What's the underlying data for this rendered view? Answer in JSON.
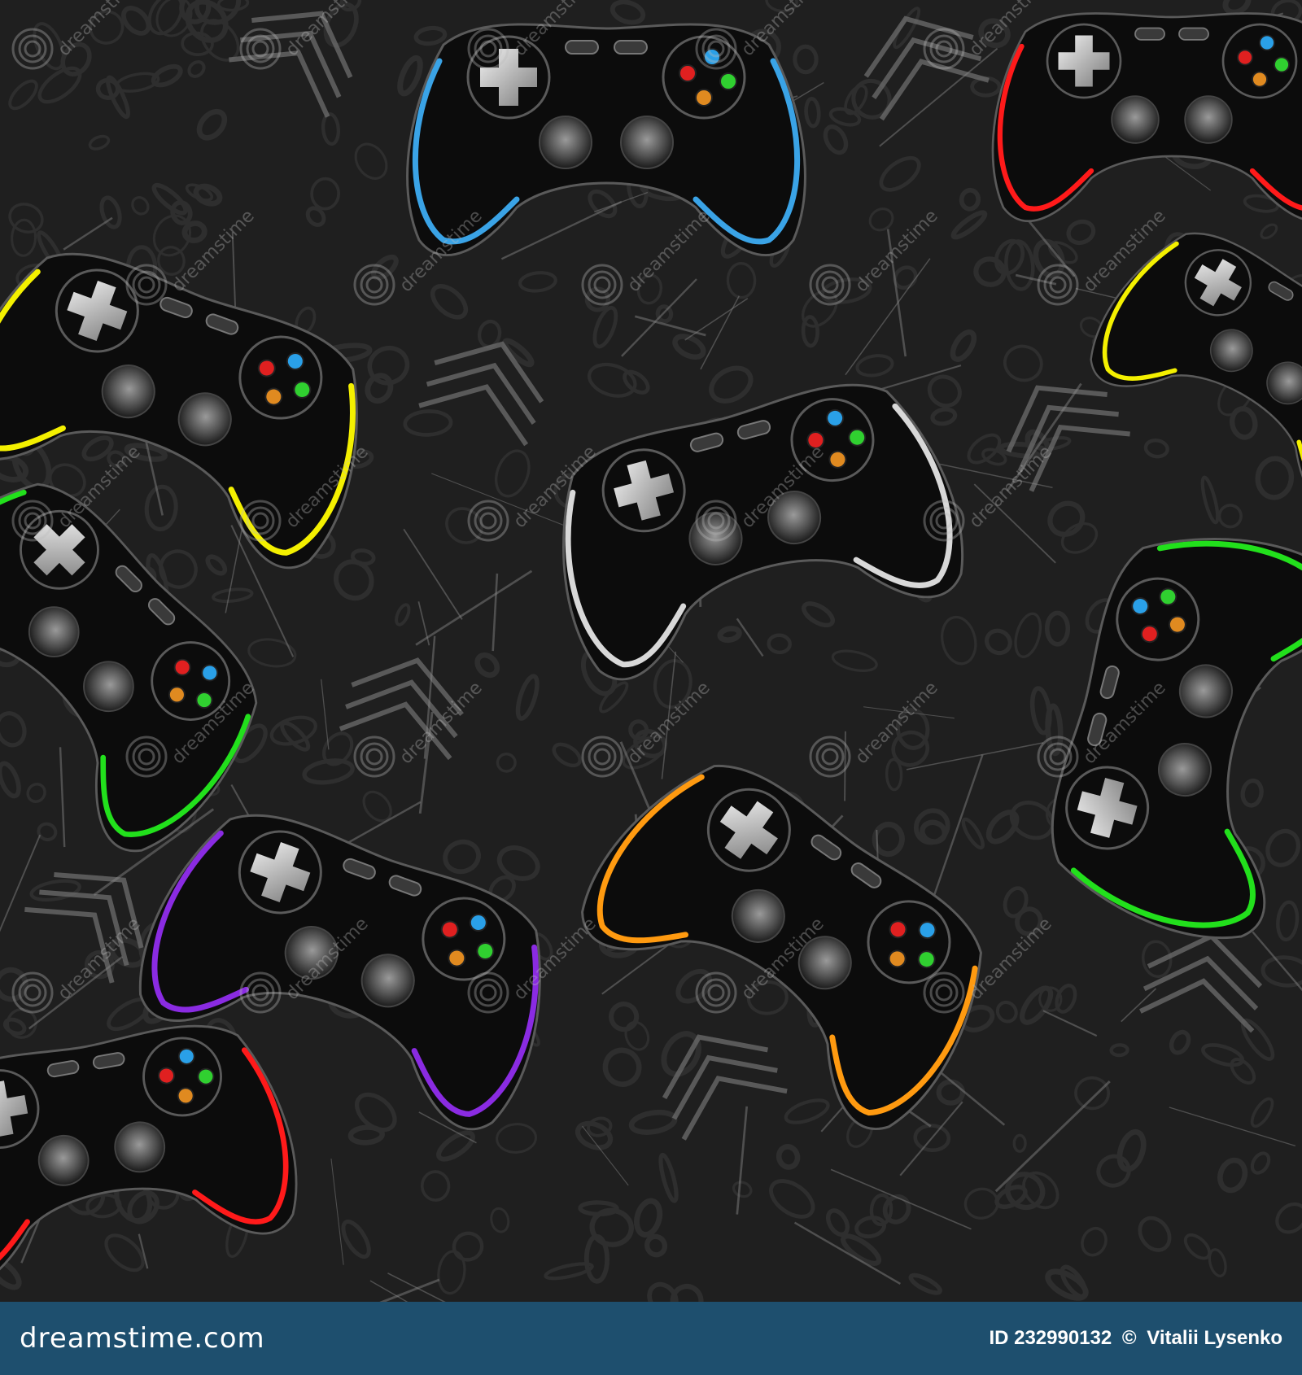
{
  "artwork": {
    "description_text": "",
    "background_color": "#1f1f1f",
    "texture_color": "#2e2e2e",
    "pattern_color": "#6d6d6d",
    "controller_body_color": "#0c0c0c",
    "controller_outline_color": "#5a5a5a",
    "controllers": [
      {
        "accent_color": "#3aa3e6",
        "icon": "gamepad-icon"
      },
      {
        "accent_color": "#ff1a1a",
        "icon": "gamepad-icon"
      },
      {
        "accent_color": "#f4f000",
        "icon": "gamepad-icon"
      },
      {
        "accent_color": "#d8d8d8",
        "icon": "gamepad-icon"
      },
      {
        "accent_color": "#22e01c",
        "icon": "gamepad-icon"
      },
      {
        "accent_color": "#22e01c",
        "icon": "gamepad-icon"
      },
      {
        "accent_color": "#f4f000",
        "icon": "gamepad-icon"
      },
      {
        "accent_color": "#8a2be2",
        "icon": "gamepad-icon"
      },
      {
        "accent_color": "#ff9a10",
        "icon": "gamepad-icon"
      },
      {
        "accent_color": "#ff1a1a",
        "icon": "gamepad-icon"
      }
    ],
    "face_button_colors": [
      "#e02020",
      "#2aa0e8",
      "#30d030",
      "#e08a20"
    ]
  },
  "watermark": {
    "text": "dreamstime"
  },
  "footer": {
    "brand_label": "dreamstime.com",
    "id_label": "ID 232990132",
    "copyright_symbol": "©",
    "author": "Vitalii Lysenko",
    "bar_color": "#1e4f6e"
  }
}
